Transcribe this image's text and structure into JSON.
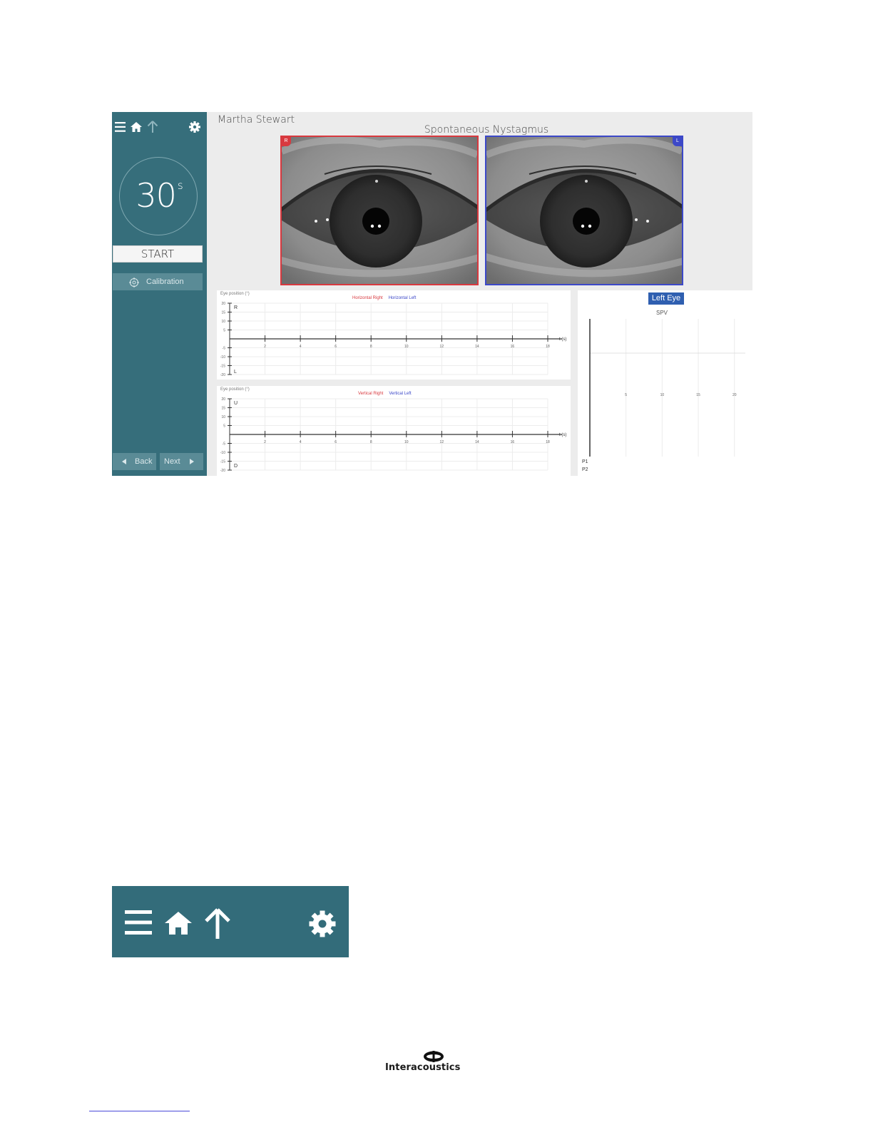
{
  "app": {
    "patient_name": "Martha Stewart",
    "test_title": "Spontaneous Nystagmus",
    "sidebar": {
      "icons": [
        "menu-icon",
        "home-icon",
        "up-arrow-icon",
        "gear-icon"
      ],
      "timer_value": "30",
      "timer_unit": "s",
      "start_label": "START",
      "calibration_label": "Calibration",
      "back_label": "Back",
      "next_label": "Next"
    },
    "eyes": {
      "right_tag": "R",
      "left_tag": "L",
      "right_color": "#d8393f",
      "left_color": "#3c48c8"
    },
    "horizontal_panel": {
      "title": "Eye position (°)",
      "legend_right": "Horizontal Right",
      "legend_left": "Horizontal Left",
      "top_direction": "R",
      "bottom_direction": "L",
      "time_unit": "t (s)"
    },
    "vertical_panel": {
      "title": "Eye position (°)",
      "legend_right": "Vertical Right",
      "legend_left": "Vertical Left",
      "top_direction": "U",
      "bottom_direction": "D",
      "time_unit": "t (s)"
    },
    "spv_panel": {
      "eye_button": "Left Eye",
      "label": "SPV",
      "bottom_labels": [
        "P1",
        "P2"
      ]
    }
  },
  "chart_data": [
    {
      "type": "line",
      "title": "Eye position (°)",
      "series": [
        {
          "name": "Horizontal Right",
          "color": "#d8393f",
          "values": []
        },
        {
          "name": "Horizontal Left",
          "color": "#3c48c8",
          "values": []
        }
      ],
      "x_ticks": [
        "2",
        "4",
        "6",
        "8",
        "10",
        "12",
        "14",
        "16",
        "18"
      ],
      "y_ticks": [
        "20",
        "15",
        "10",
        "5",
        "-5",
        "-10",
        "-15",
        "-20"
      ],
      "ylim": [
        -20,
        20
      ],
      "xlim": [
        0,
        18
      ],
      "grid": true,
      "legend": "top-center"
    },
    {
      "type": "line",
      "title": "Eye position (°)",
      "series": [
        {
          "name": "Vertical Right",
          "color": "#d8393f",
          "values": []
        },
        {
          "name": "Vertical Left",
          "color": "#3c48c8",
          "values": []
        }
      ],
      "x_ticks": [
        "2",
        "4",
        "6",
        "8",
        "10",
        "12",
        "14",
        "16",
        "18"
      ],
      "y_ticks": [
        "20",
        "15",
        "10",
        "5",
        "-5",
        "-10",
        "-15",
        "-20"
      ],
      "ylim": [
        -20,
        20
      ],
      "xlim": [
        0,
        18
      ],
      "grid": true,
      "legend": "top-center"
    },
    {
      "type": "scatter",
      "title": "SPV",
      "x_ticks": [
        "5",
        "10",
        "15",
        "20"
      ],
      "values": [],
      "grid": true
    }
  ],
  "toolbar_zoom": {
    "icons": [
      "menu-icon",
      "home-icon",
      "up-arrow-icon",
      "gear-icon"
    ],
    "background": "#336c7a"
  },
  "footer": {
    "brand": "Interacoustics"
  }
}
